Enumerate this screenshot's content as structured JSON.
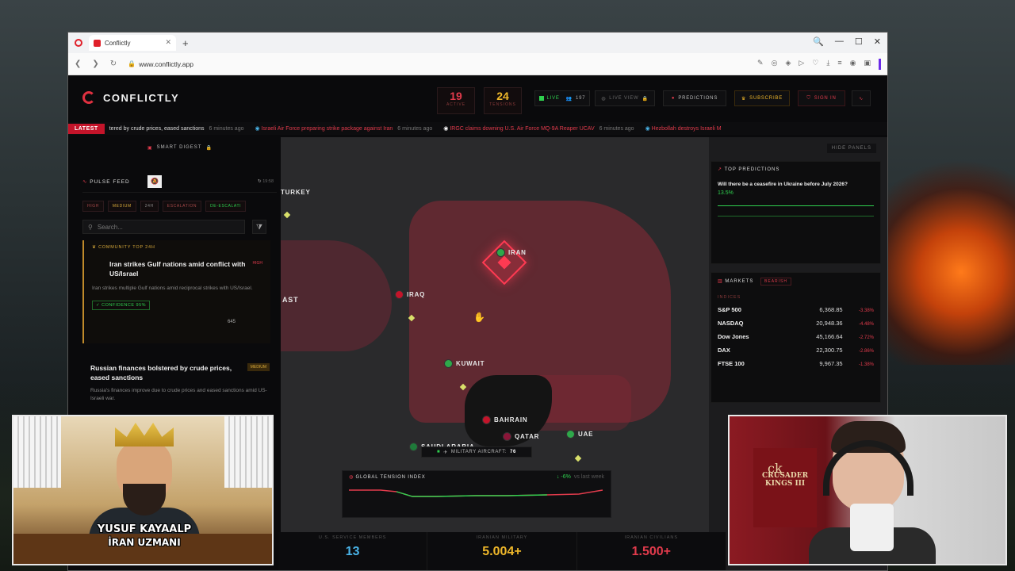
{
  "browser": {
    "tab_title": "Conflictly",
    "new_tab": "+",
    "url": "www.conflictly.app",
    "window_controls": [
      "🔍",
      "—",
      "☐",
      "✕"
    ]
  },
  "app": {
    "brand": "CONFLICTLY",
    "stats": [
      {
        "value": "19",
        "label": "ACTIVE",
        "color": "#e23b4c"
      },
      {
        "value": "24",
        "label": "TENSIONS",
        "color": "#f0b82a"
      }
    ],
    "live_label": "LIVE",
    "viewers": "197",
    "live_view_label": "LIVE VIEW",
    "predictions_label": "PREDICTIONS",
    "subscribe_label": "SUBSCRIBE",
    "sign_in_label": "SIGN IN"
  },
  "ticker": {
    "latest_label": "LATEST",
    "items": [
      {
        "text": "tered by crude prices, eased sanctions",
        "time": "6 minutes ago",
        "red": false
      },
      {
        "text": "Israeli Air Force preparing strike package against Iran",
        "time": "6 minutes ago",
        "red": true
      },
      {
        "text": "IRGC claims downing U.S. Air Force MQ-9A Reaper UCAV",
        "time": "6 minutes ago",
        "red": true
      },
      {
        "text": "Hezbollah destroys Israeli M",
        "time": "",
        "red": true
      }
    ]
  },
  "left_panel": {
    "smart_digest": "SMART DIGEST",
    "pulse_feed": "PULSE FEED",
    "pulse_time": "19:58",
    "filters": [
      "HIGH",
      "MEDIUM",
      "24H",
      "ESCALATION",
      "DE-ESCALATI"
    ],
    "search_placeholder": "Search...",
    "card1": {
      "community": "COMMUNITY TOP 24H",
      "badge": "HIGH",
      "title": "Iran strikes Gulf nations amid conflict with US/Israel",
      "body": "Iran strikes multiple Gulf nations amid reciprocal strikes with US/Israel.",
      "confidence": "CONFIDENCE 95%",
      "count": "645"
    },
    "card2": {
      "badge": "MEDIUM",
      "title": "Russian finances bolstered by crude prices, eased sanctions",
      "body": "Russia's finances improve due to crude prices and eased sanctions amid US-Israeli war."
    }
  },
  "map": {
    "labels": [
      {
        "name": "TURKEY"
      },
      {
        "name": "IRAN",
        "flag": "#2ea84a"
      },
      {
        "name": "IRAQ",
        "flag": "#c4142a"
      },
      {
        "name": "AST"
      },
      {
        "name": "KUWAIT",
        "flag": "#2ea84a"
      },
      {
        "name": "BAHRAIN",
        "flag": "#c4142a"
      },
      {
        "name": "QATAR",
        "flag": "#8a1538"
      },
      {
        "name": "UAE",
        "flag": "#2ea84a"
      },
      {
        "name": "SAUDI ARABIA",
        "flag": "#1f7a3a"
      }
    ],
    "hide_panels": "HIDE PANELS",
    "aircraft_label": "MILITARY AIRCRAFT:",
    "aircraft_count": "76"
  },
  "predictions": {
    "title": "TOP PREDICTIONS",
    "question": "Will there be a ceasefire in Ukraine before July 2026?",
    "percent": "13.5%"
  },
  "markets": {
    "title": "MARKETS",
    "sentiment": "BEARISH",
    "section": "INDICES",
    "rows": [
      {
        "name": "S&P 500",
        "value": "6,368.85",
        "change": "-3.38%"
      },
      {
        "name": "NASDAQ",
        "value": "20,948.36",
        "change": "-4.48%"
      },
      {
        "name": "Dow Jones",
        "value": "45,166.64",
        "change": "-2.72%"
      },
      {
        "name": "DAX",
        "value": "22,300.75",
        "change": "-2.86%"
      },
      {
        "name": "FTSE 100",
        "value": "9,967.35",
        "change": "-1.38%"
      }
    ]
  },
  "tension": {
    "title": "GLOBAL TENSION INDEX",
    "delta": "↓ -6%",
    "delta_suffix": "vs last week"
  },
  "bottom_stats": [
    {
      "label": "U.S. SERVICE MEMBERS",
      "value": "13",
      "color": "#4ab4e8"
    },
    {
      "label": "IRANIAN MILITARY",
      "value": "5.004+",
      "color": "#f0b82a"
    },
    {
      "label": "IRANIAN CIVILIANS",
      "value": "1.500+",
      "color": "#e23b4c"
    }
  ],
  "webcam_left": {
    "caption_line1": "YUSUF KAYAALP",
    "caption_line2": "İRAN UZMANI"
  },
  "webcam_right": {
    "banner_text": "CRUSADER KINGS III",
    "logo": "ck"
  }
}
